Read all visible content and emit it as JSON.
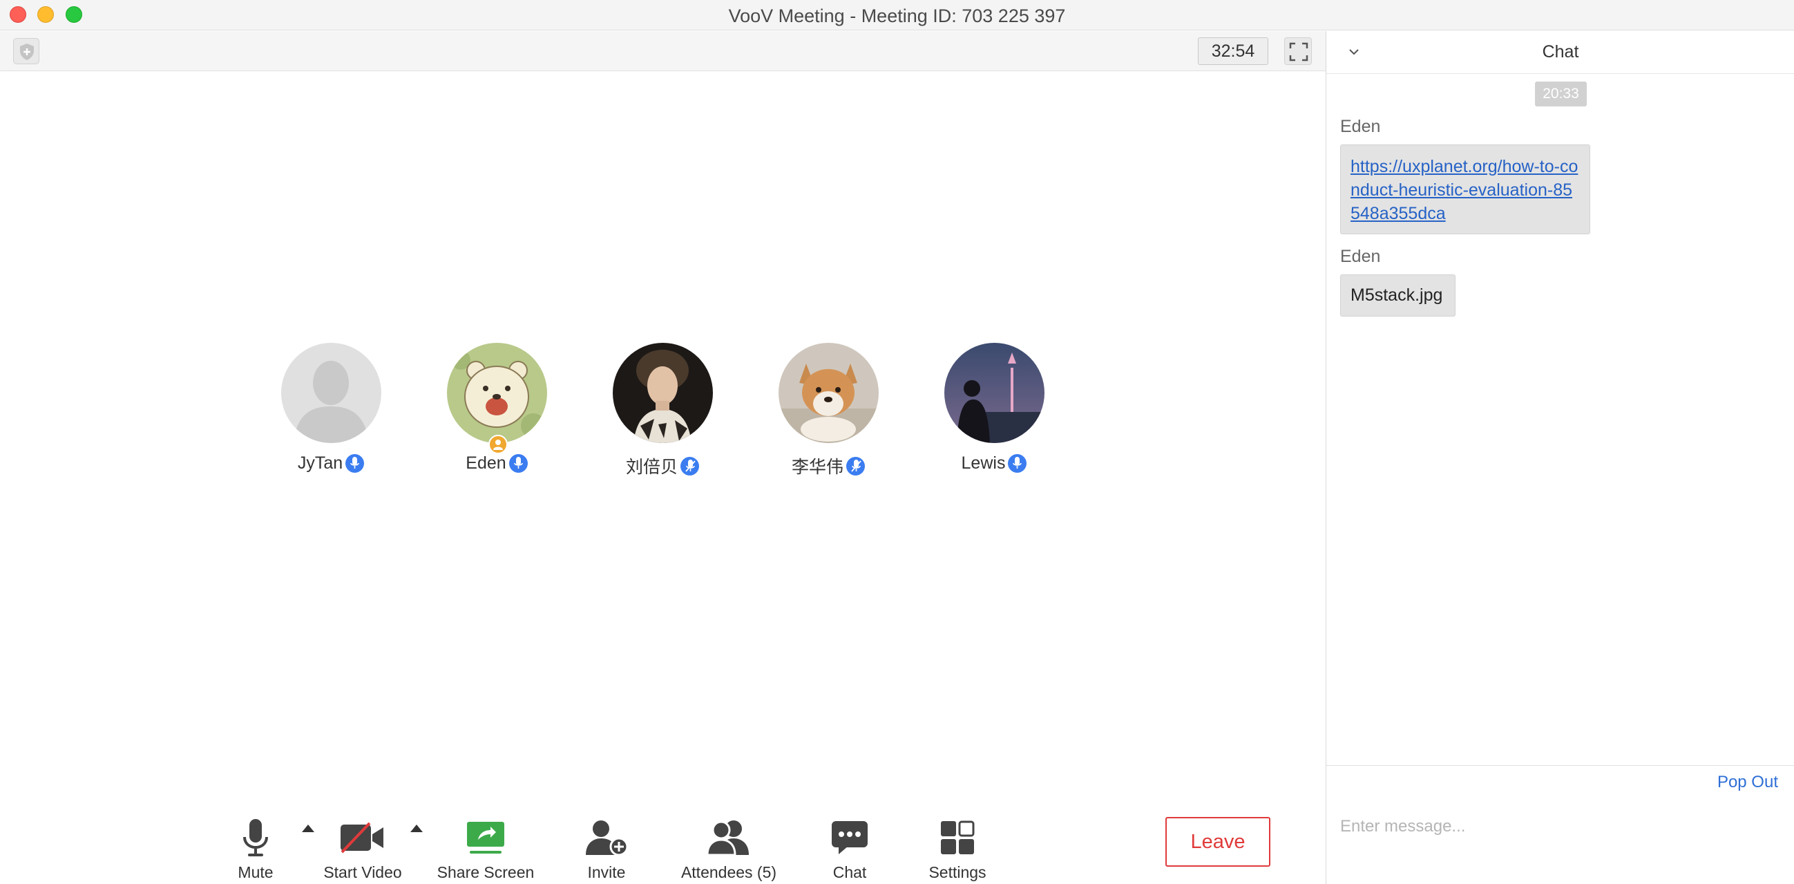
{
  "window": {
    "title": "VooV Meeting - Meeting ID: 703 225 397"
  },
  "topbar": {
    "timer": "32:54",
    "icons": [
      "shield-icon",
      "fullscreen-icon"
    ]
  },
  "participants": [
    {
      "name": "JyTan",
      "avatar": "default-avatar",
      "mic": "unmuted"
    },
    {
      "name": "Eden",
      "avatar": "cartoon-bear",
      "mic": "unmuted",
      "host": true
    },
    {
      "name": "刘倍贝",
      "avatar": "woman-portrait",
      "mic": "muted"
    },
    {
      "name": "李华伟",
      "avatar": "shiba-dog",
      "mic": "muted"
    },
    {
      "name": "Lewis",
      "avatar": "city-night-silhouette",
      "mic": "unmuted"
    }
  ],
  "toolbar": {
    "mute_label": "Mute",
    "video_label": "Start Video",
    "share_label": "Share Screen",
    "invite_label": "Invite",
    "attendees_label": "Attendees (5)",
    "chat_label": "Chat",
    "settings_label": "Settings",
    "leave_label": "Leave"
  },
  "chat": {
    "title": "Chat",
    "timestamp": "20:33",
    "messages": [
      {
        "sender": "Eden",
        "text": "https://uxplanet.org/how-to-conduct-heuristic-evaluation-85548a355dca",
        "type": "link"
      },
      {
        "sender": "Eden",
        "text": "M5stack.jpg",
        "type": "file"
      }
    ],
    "pop_out_label": "Pop Out",
    "input_placeholder": "Enter message..."
  },
  "colors": {
    "accent_blue": "#3b7df0",
    "leave_red": "#e03a3a",
    "share_green": "#3daa4a",
    "link_blue": "#2662c6"
  }
}
